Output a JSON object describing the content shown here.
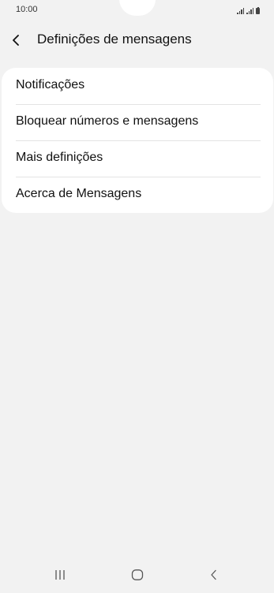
{
  "status_bar": {
    "time": "10:00",
    "icons": [
      "signal-icon",
      "signal-icon",
      "battery-icon"
    ]
  },
  "header": {
    "back_icon": "chevron-left-icon",
    "title": "Definições de mensagens"
  },
  "menu": {
    "items": [
      {
        "label": "Notificações"
      },
      {
        "label": "Bloquear números e mensagens"
      },
      {
        "label": "Mais definições"
      },
      {
        "label": "Acerca de Mensagens"
      }
    ]
  },
  "nav_bar": {
    "buttons": [
      "recent-apps-icon",
      "home-icon",
      "back-icon"
    ]
  },
  "colors": {
    "background": "#f2f2f2",
    "card": "#ffffff",
    "text": "#111111",
    "divider": "#e3e3e3"
  }
}
